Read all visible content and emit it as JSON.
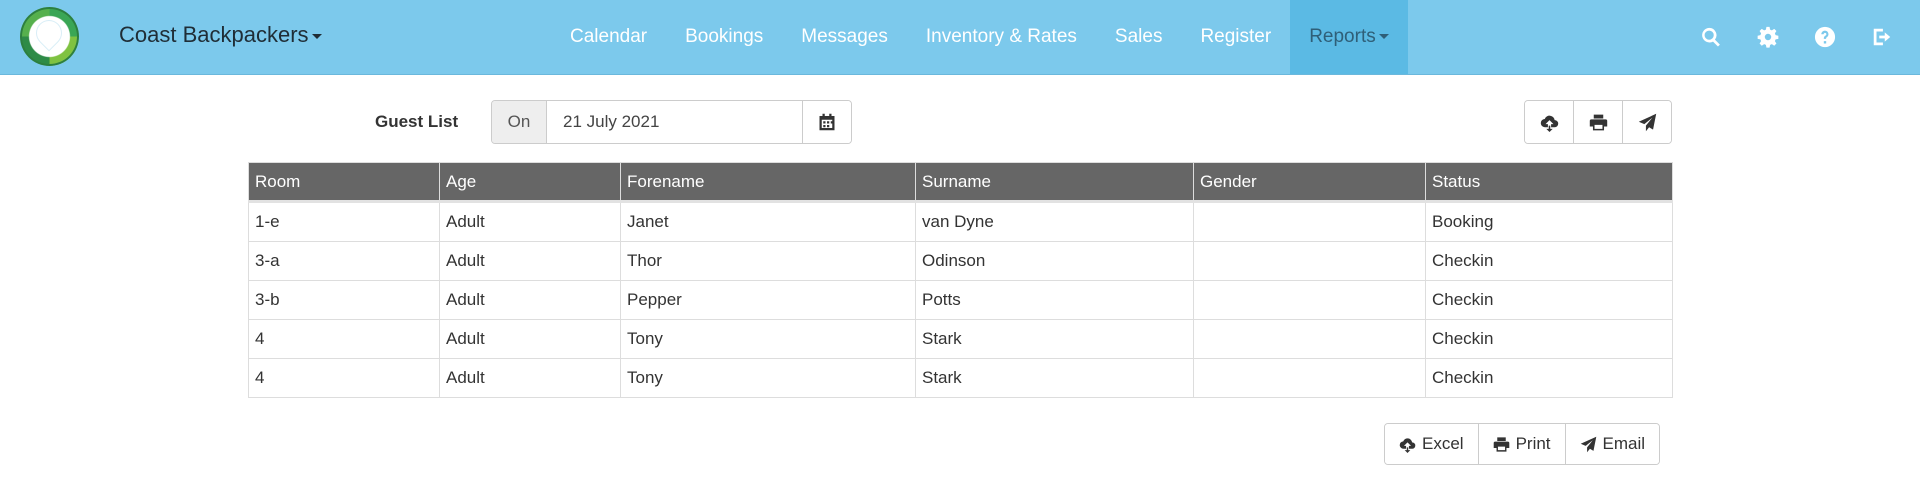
{
  "app": {
    "brand": "Coast Backpackers"
  },
  "nav": {
    "items": [
      {
        "label": "Calendar"
      },
      {
        "label": "Bookings"
      },
      {
        "label": "Messages"
      },
      {
        "label": "Inventory & Rates"
      },
      {
        "label": "Sales"
      },
      {
        "label": "Register"
      },
      {
        "label": "Reports"
      }
    ],
    "active": "Reports",
    "icons": [
      "search-icon",
      "gear-icon",
      "help-icon",
      "logout-icon"
    ]
  },
  "toolbar": {
    "title": "Guest List",
    "on_label": "On",
    "date_value": "21 July 2021"
  },
  "table": {
    "headers": [
      "Room",
      "Age",
      "Forename",
      "Surname",
      "Gender",
      "Status"
    ],
    "rows": [
      [
        "1-e",
        "Adult",
        "Janet",
        "van Dyne",
        "",
        "Booking"
      ],
      [
        "3-a",
        "Adult",
        "Thor",
        "Odinson",
        "",
        "Checkin"
      ],
      [
        "3-b",
        "Adult",
        "Pepper",
        "Potts",
        "",
        "Checkin"
      ],
      [
        "4",
        "Adult",
        "Tony",
        "Stark",
        "",
        "Checkin"
      ],
      [
        "4",
        "Adult",
        "Tony",
        "Stark",
        "",
        "Checkin"
      ]
    ]
  },
  "export": {
    "excel": "Excel",
    "print": "Print",
    "email": "Email"
  },
  "colors": {
    "navbar": "#7cc9ec",
    "nav_active": "#5bbae4",
    "table_header": "#666666"
  }
}
